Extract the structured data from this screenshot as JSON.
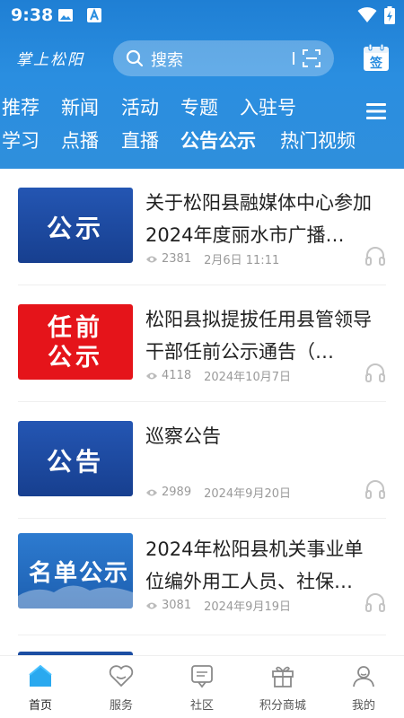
{
  "status_bar": {
    "time": "9:38",
    "icons": [
      "image-icon",
      "a-icon",
      "wifi-icon",
      "battery-charging-icon"
    ]
  },
  "header": {
    "logo": "掌上松阳",
    "search": {
      "placeholder": "搜索"
    },
    "sign_label": "签"
  },
  "nav": {
    "row1": [
      "推荐",
      "新闻",
      "活动",
      "专题",
      "入驻号"
    ],
    "row2": [
      "学习",
      "点播",
      "直播",
      "公告公示",
      "热门视频"
    ],
    "active": "公告公示"
  },
  "articles": [
    {
      "thumb_text": "公示",
      "thumb_style": "blue",
      "title": "关于松阳县融媒体中心参加2024年度丽水市广播…",
      "views": "2381",
      "date": "2月6日 11:11"
    },
    {
      "thumb_text": "任前公示",
      "thumb_style": "red",
      "title": "松阳县拟提拔任用县管领导干部任前公示通告（…",
      "views": "4118",
      "date": "2024年10月7日"
    },
    {
      "thumb_text": "公告",
      "thumb_style": "blue",
      "title": "巡察公告",
      "views": "2989",
      "date": "2024年9月20日"
    },
    {
      "thumb_text": "名单公示",
      "thumb_style": "blue-photo",
      "title": "2024年松阳县机关事业单位编外用工人员、社保…",
      "views": "3081",
      "date": "2024年9月19日"
    }
  ],
  "tabbar": [
    {
      "label": "首页",
      "icon": "home-icon",
      "active": true
    },
    {
      "label": "服务",
      "icon": "heart-icon",
      "active": false
    },
    {
      "label": "社区",
      "icon": "chat-icon",
      "active": false
    },
    {
      "label": "积分商城",
      "icon": "gift-icon",
      "active": false
    },
    {
      "label": "我的",
      "icon": "user-icon",
      "active": false
    }
  ],
  "colors": {
    "brand_blue": "#2a8ee0",
    "notice_red": "#e5141a",
    "notice_blue": "#1c4ea3"
  }
}
